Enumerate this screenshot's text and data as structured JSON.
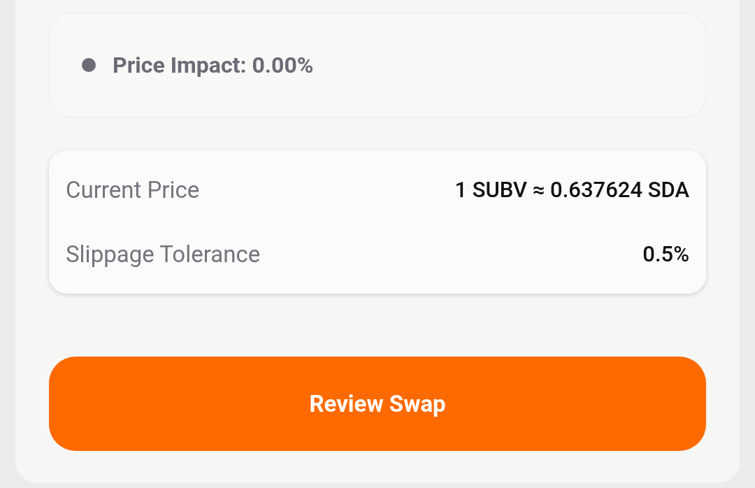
{
  "price_impact": {
    "text": "Price Impact: 0.00%"
  },
  "details": [
    {
      "label": "Current Price",
      "value": "1 SUBV ≈ 0.637624 SDA"
    },
    {
      "label": "Slippage Tolerance",
      "value": "0.5%"
    }
  ],
  "button": {
    "label": "Review Swap"
  }
}
